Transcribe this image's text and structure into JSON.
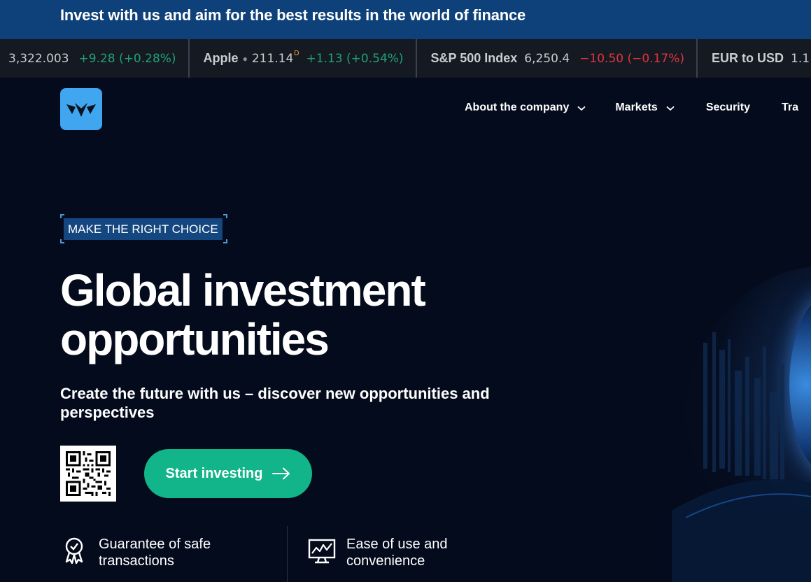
{
  "banner": {
    "text": "Invest with us and aim for the best results in the world of finance"
  },
  "ticker": [
    {
      "name": "",
      "price": "3,322.003",
      "flag": "",
      "change": "+9.28 (+0.28%)",
      "direction": "up"
    },
    {
      "name": "Apple",
      "price": "211.14",
      "flag": "D",
      "change": "+1.13 (+0.54%)",
      "direction": "up"
    },
    {
      "name": "S&P 500 Index",
      "price": "6,250.4",
      "flag": "",
      "change": "−10.50 (−0.17%)",
      "direction": "down"
    },
    {
      "name": "EUR to USD",
      "price": "1.1",
      "flag": "",
      "change": "",
      "direction": ""
    }
  ],
  "header": {
    "logo_icon": "crown-logo-icon",
    "nav": [
      {
        "label": "About the company",
        "has_dropdown": true
      },
      {
        "label": "Markets",
        "has_dropdown": true
      },
      {
        "label": "Security",
        "has_dropdown": false
      },
      {
        "label": "Tra",
        "has_dropdown": false
      }
    ]
  },
  "hero": {
    "tag": "MAKE THE RIGHT CHOICE",
    "title": "Global investment opportunities",
    "subtitle": "Create the future with us – discover new opportunities and perspectives",
    "cta_label": "Start investing",
    "qr_icon": "qr-code-icon"
  },
  "features": [
    {
      "icon": "award-ribbon-icon",
      "text": "Guarantee of safe transactions"
    },
    {
      "icon": "chart-monitor-icon",
      "text": "Ease of use and convenience"
    }
  ],
  "colors": {
    "background": "#040b1c",
    "banner": "#0e4079",
    "ticker_bg": "#151a22",
    "accent_green": "#12b48a",
    "up": "#1fa27a",
    "down": "#e0333f",
    "logo": "#3fa6ef",
    "tag_bg": "#14467f"
  }
}
